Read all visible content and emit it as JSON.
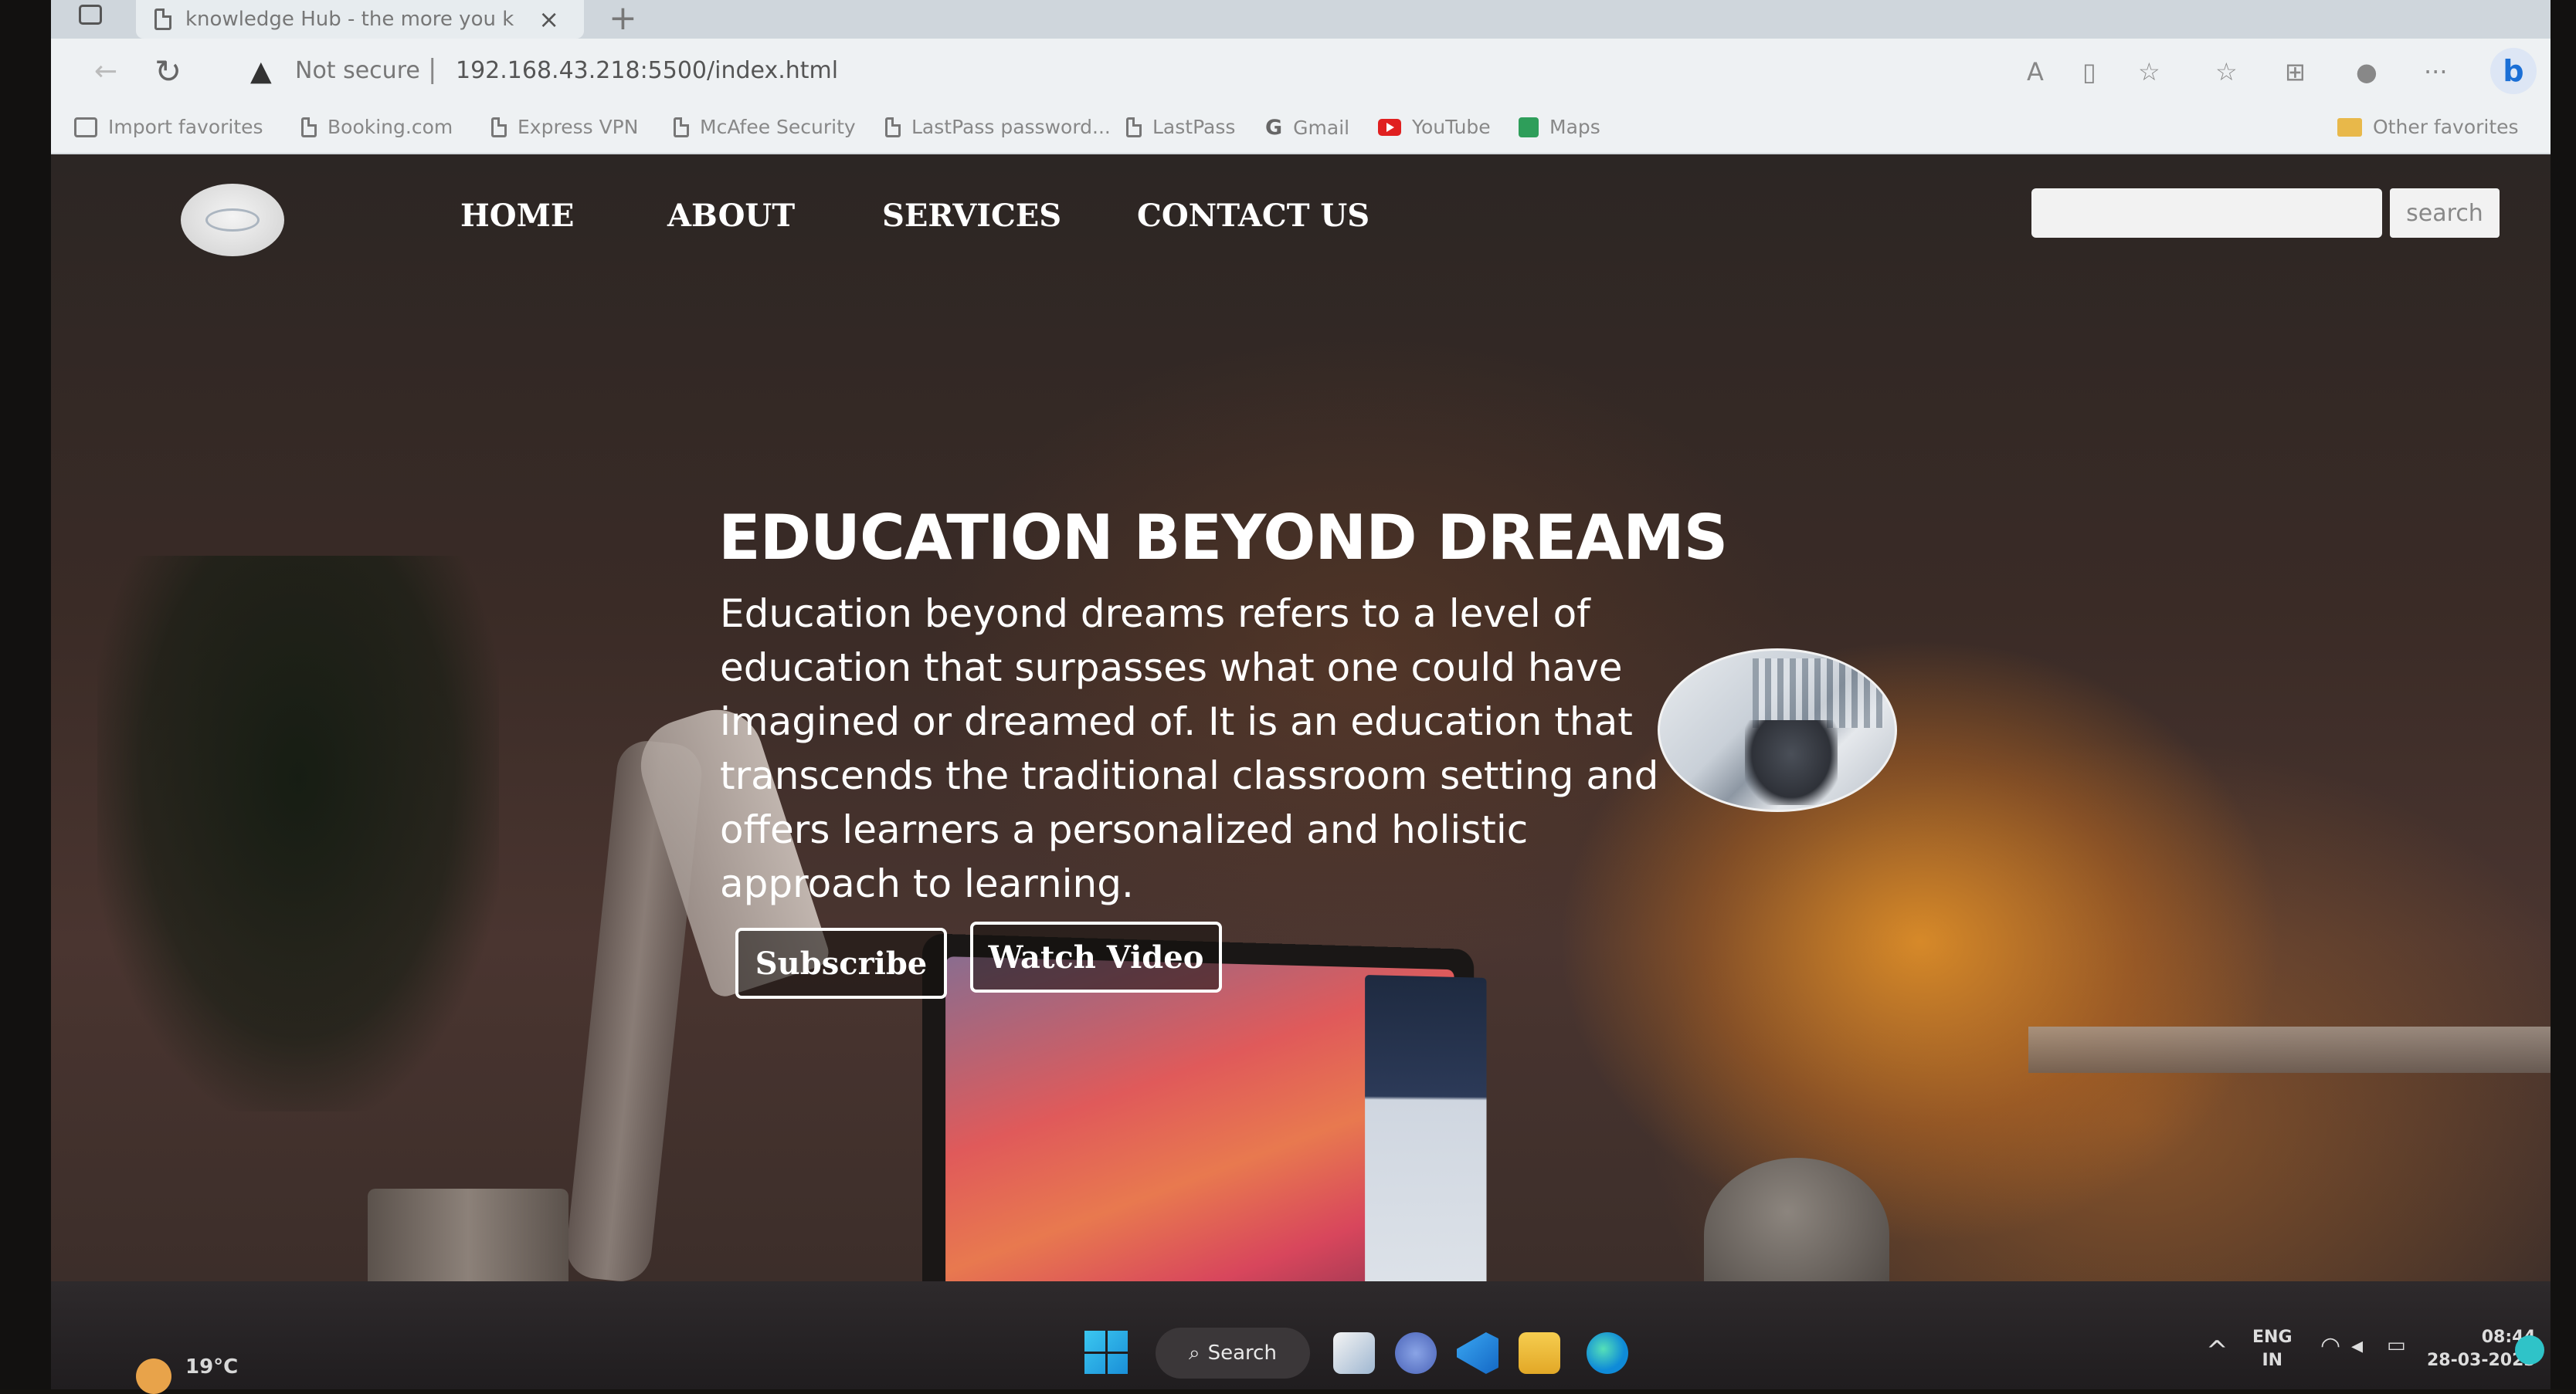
{
  "browser": {
    "tab_title": "knowledge Hub - the more you k",
    "tab_close": "×",
    "new_tab": "+",
    "security_label": "Not secure",
    "url": "192.168.43.218:5500/index.html",
    "favorites": [
      {
        "label": "Import favorites",
        "icon": "import-icon"
      },
      {
        "label": "Booking.com",
        "icon": "page-icon"
      },
      {
        "label": "Express VPN",
        "icon": "page-icon"
      },
      {
        "label": "McAfee Security",
        "icon": "page-icon"
      },
      {
        "label": "LastPass password...",
        "icon": "page-icon"
      },
      {
        "label": "LastPass",
        "icon": "page-icon"
      },
      {
        "label": "Gmail",
        "icon": "google-icon"
      },
      {
        "label": "YouTube",
        "icon": "youtube-icon"
      },
      {
        "label": "Maps",
        "icon": "maps-icon"
      }
    ],
    "other_favorites": "Other favorites"
  },
  "site": {
    "nav": {
      "home": "HOME",
      "about": "ABOUT",
      "services": "SERVICES",
      "contact": "CONTACT US"
    },
    "search": {
      "placeholder": "",
      "button": "search"
    },
    "hero": {
      "title": "EDUCATION BEYOND DREAMS",
      "text": "Education beyond dreams refers to a level of education that surpasses what one could have imagined or dreamed of. It is an education that transcends the traditional classroom setting and offers learners a personalized and holistic approach to learning.",
      "subscribe_button": "Subscribe",
      "watch_video_button": "Watch Video"
    }
  },
  "taskbar": {
    "weather_temp": "19°C",
    "search_label": "Search",
    "lang_line1": "ENG",
    "lang_line2": "IN",
    "time": "08:44",
    "date": "28-03-2023"
  }
}
